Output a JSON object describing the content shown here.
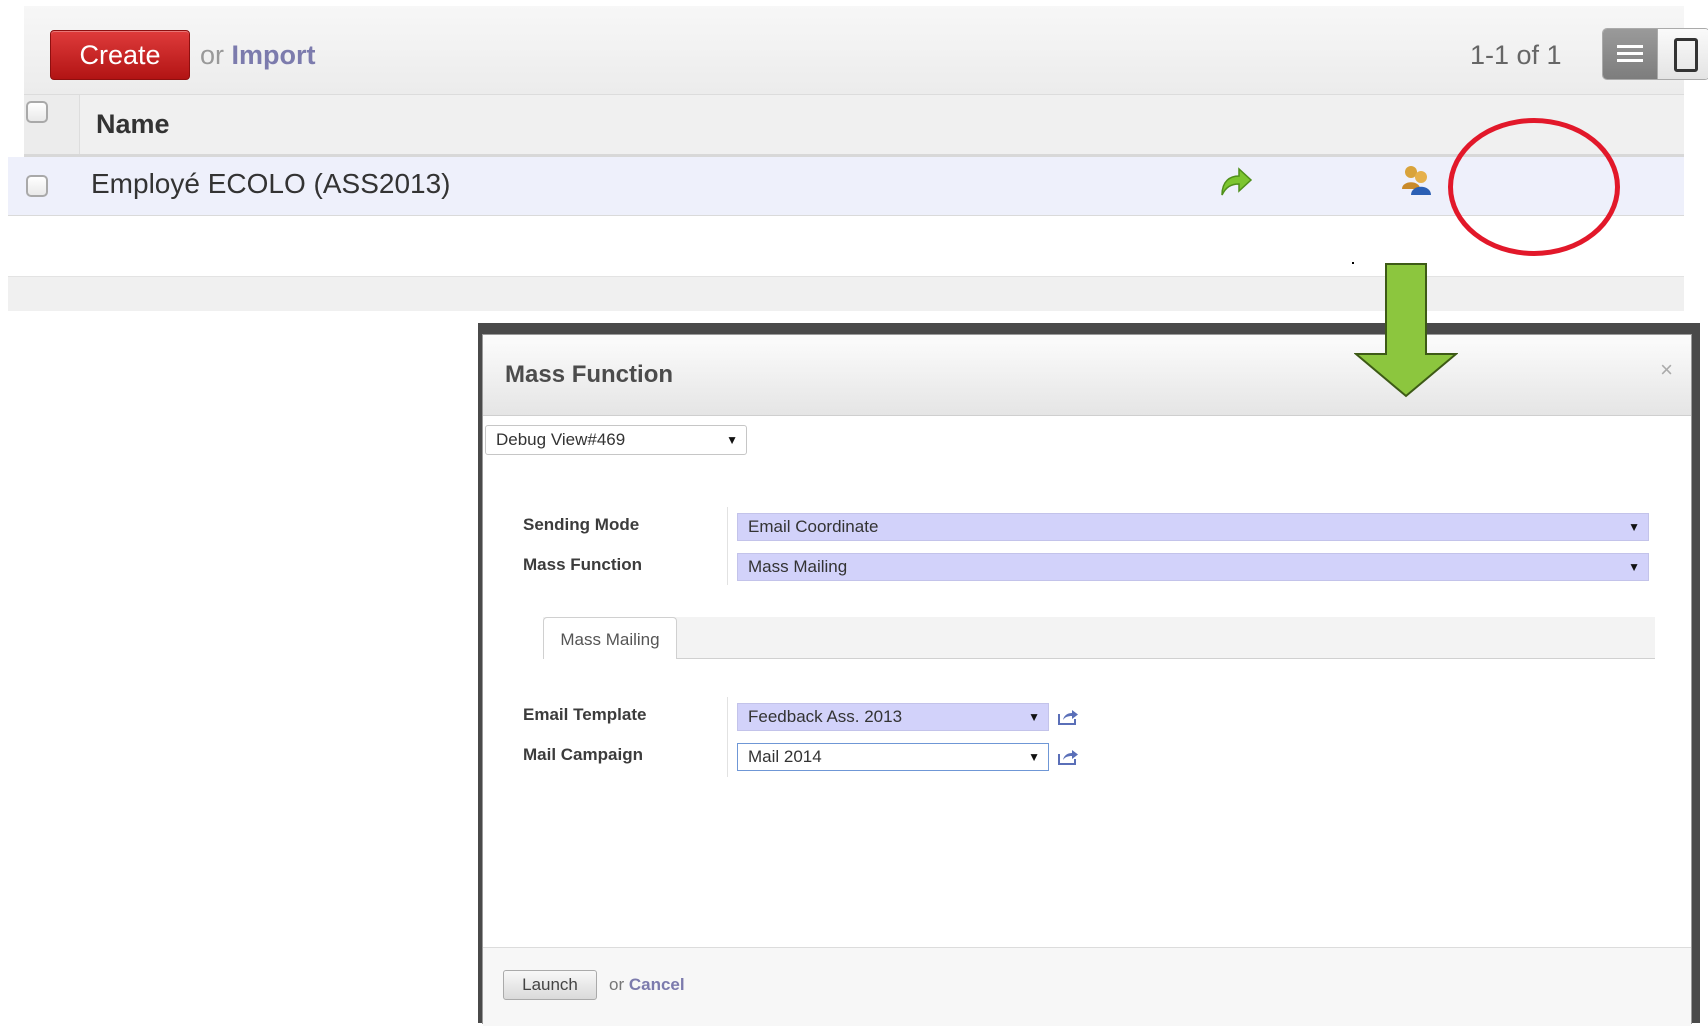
{
  "toolbar": {
    "create_label": "Create",
    "or_text": "or",
    "import_label": "Import",
    "pager_text": "1-1 of 1"
  },
  "list": {
    "columns": [
      "Name"
    ],
    "rows": [
      {
        "name": "Employé ECOLO (ASS2013)"
      }
    ]
  },
  "icons": {
    "forward": "green-forward-arrow-icon",
    "mass_function": "mass-function-users-icon",
    "list_view": "list-view-icon",
    "form_view": "form-view-icon"
  },
  "colors": {
    "create_button": "#c81e1e",
    "highlight_circle": "#e2182a",
    "arrow": "#8cc63e",
    "field_required_bg": "#d2d2fa",
    "link": "#7c7bad"
  },
  "dialog": {
    "title": "Mass Function",
    "close": "×",
    "debug_select": "Debug View#469",
    "fields": {
      "sending_mode": {
        "label": "Sending Mode",
        "value": "Email Coordinate"
      },
      "mass_function": {
        "label": "Mass Function",
        "value": "Mass Mailing"
      }
    },
    "tab_label": "Mass Mailing",
    "tab_fields": {
      "email_template": {
        "label": "Email Template",
        "value": "Feedback Ass. 2013"
      },
      "mail_campaign": {
        "label": "Mail Campaign",
        "value": "Mail 2014"
      }
    },
    "footer": {
      "launch_label": "Launch",
      "or_text": "or",
      "cancel_label": "Cancel"
    }
  },
  "glyphs": {
    "caret": "▼"
  }
}
